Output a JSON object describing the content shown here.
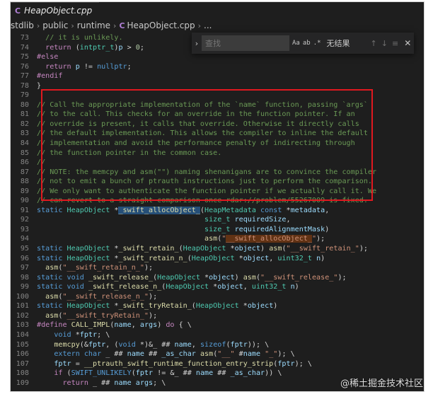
{
  "tab": {
    "label": "HeapObject.cpp",
    "icon": "C"
  },
  "breadcrumb": [
    "stdlib",
    "public",
    "runtime",
    "HeapObject.cpp",
    "..."
  ],
  "find_widget": {
    "placeholder": "查找",
    "options": [
      "Aa",
      "ab",
      ".*"
    ],
    "result": "无结果"
  },
  "watermark": "@稀土掘金技术社区",
  "colors": {
    "editor_bg": "#1e1e1e",
    "highlight_box": "#e0191f",
    "selection": "#264f78"
  },
  "code_lines": [
    {
      "n": "73",
      "html": "  <span class=\"cm\">// it is unlikely.</span>"
    },
    {
      "n": "74",
      "html": "  <span class=\"ctl\">return</span> (<span class=\"ty\">intptr_t</span>)<span class=\"var\">p</span> &gt; <span class=\"num\">0</span>;"
    },
    {
      "n": "75",
      "html": "<span class=\"pp\">#else</span>"
    },
    {
      "n": "76",
      "html": "  <span class=\"ctl\">return</span> <span class=\"var\">p</span> != <span class=\"kw\">nullptr</span>;"
    },
    {
      "n": "77",
      "html": "<span class=\"pp\">#endif</span>"
    },
    {
      "n": "78",
      "html": "}"
    },
    {
      "n": "79",
      "html": ""
    },
    {
      "n": "80",
      "html": "<span class=\"cm\">// Call the appropriate implementation of the `name` function, passing `args`</span>"
    },
    {
      "n": "81",
      "html": "<span class=\"cm\">// to the call. This checks for an override in the function pointer. If an</span>"
    },
    {
      "n": "82",
      "html": "<span class=\"cm\">// override is present, it calls that override. Otherwise it directly calls</span>"
    },
    {
      "n": "83",
      "html": "<span class=\"cm\">// the default implementation. This allows the compiler to inline the default</span>"
    },
    {
      "n": "84",
      "html": "<span class=\"cm\">// implementation and avoid the performance penalty of indirecting through</span>"
    },
    {
      "n": "85",
      "html": "<span class=\"cm\">// the function pointer in the common case.</span>"
    },
    {
      "n": "86",
      "html": "<span class=\"cm\">//</span>"
    },
    {
      "n": "87",
      "html": "<span class=\"cm\">// NOTE: the memcpy and asm(\"\") naming shenanigans are to convince the compiler</span>"
    },
    {
      "n": "88",
      "html": "<span class=\"cm\">// not to emit a bunch of ptrauth instructions just to perform the comparison.</span>"
    },
    {
      "n": "89",
      "html": "<span class=\"cm\">// We only want to authenticate the function pointer if we actually call it. We</span>"
    },
    {
      "n": "90",
      "html": "<span class=\"cm\">// can revert to a straight comparison once rdar://problem/55267009 is fixed.</span>"
    },
    {
      "n": "91",
      "html": "<span class=\"kw\">static</span> <span class=\"ty\">HeapObject</span> *<span class=\"fn hl\">_swift_allocObject_</span>(<span class=\"ty\">HeapMetadata</span> <span class=\"kw\">const</span> *<span class=\"var\">metadata</span>,"
    },
    {
      "n": "92",
      "html": "                                       <span class=\"ty\">size_t</span> <span class=\"var\">requiredSize</span>,"
    },
    {
      "n": "93",
      "html": "                                       <span class=\"ty\">size_t</span> <span class=\"var\">requiredAlignmentMask</span>)"
    },
    {
      "n": "94",
      "html": "                                       <span class=\"fn\">asm</span>(<span class=\"str\">\"<span class=\"shl\">__swift_allocObject_</span>\"</span>);"
    },
    {
      "n": "95",
      "html": "<span class=\"kw\">static</span> <span class=\"ty\">HeapObject</span> *<span class=\"fn\">_swift_retain_</span>(<span class=\"ty\">HeapObject</span> *<span class=\"var\">object</span>) <span class=\"fn\">asm</span>(<span class=\"str\">\"__swift_retain_\"</span>);"
    },
    {
      "n": "96",
      "html": "<span class=\"kw\">static</span> <span class=\"ty\">HeapObject</span> *<span class=\"fn\">_swift_retain_n_</span>(<span class=\"ty\">HeapObject</span> *<span class=\"var\">object</span>, <span class=\"ty\">uint32_t</span> <span class=\"var\">n</span>)"
    },
    {
      "n": "97",
      "html": "  <span class=\"fn\">asm</span>(<span class=\"str\">\"__swift_retain_n_\"</span>);"
    },
    {
      "n": "98",
      "html": "<span class=\"kw\">static</span> <span class=\"kw\">void</span> <span class=\"fn\">_swift_release_</span>(<span class=\"ty\">HeapObject</span> *<span class=\"var\">object</span>) <span class=\"fn\">asm</span>(<span class=\"str\">\"__swift_release_\"</span>);"
    },
    {
      "n": "99",
      "html": "<span class=\"kw\">static</span> <span class=\"kw\">void</span> <span class=\"fn\">_swift_release_n_</span>(<span class=\"ty\">HeapObject</span> *<span class=\"var\">object</span>, <span class=\"ty\">uint32_t</span> <span class=\"var\">n</span>)"
    },
    {
      "n": "100",
      "html": "  <span class=\"fn\">asm</span>(<span class=\"str\">\"__swift_release_n_\"</span>);"
    },
    {
      "n": "101",
      "html": "<span class=\"kw\">static</span> <span class=\"ty\">HeapObject</span> *<span class=\"fn\">_swift_tryRetain_</span>(<span class=\"ty\">HeapObject</span> *<span class=\"var\">object</span>)"
    },
    {
      "n": "102",
      "html": "  <span class=\"fn\">asm</span>(<span class=\"str\">\"__swift_tryRetain_\"</span>);"
    },
    {
      "n": "103",
      "html": "<span class=\"pp\">#define</span> <span class=\"fn\">CALL_IMPL</span>(<span class=\"var\">name</span>, <span class=\"var\">args</span>) <span class=\"ctl\">do</span> { \\"
    },
    {
      "n": "104",
      "html": "    <span class=\"kw\">void</span> *<span class=\"var\">fptr</span>; \\"
    },
    {
      "n": "105",
      "html": "    <span class=\"fn\">memcpy</span>(&amp;<span class=\"var\">fptr</span>, (<span class=\"kw\">void</span> *)&amp;_ ## <span class=\"var\">name</span>, <span class=\"kw\">sizeof</span>(<span class=\"var\">fptr</span>)); \\"
    },
    {
      "n": "106",
      "html": "    <span class=\"kw\">extern</span> <span class=\"kw\">char</span> _ ## <span class=\"var\">name</span> ## <span class=\"var\">_as_char</span> <span class=\"fn\">asm</span>(<span class=\"str\">\"__\"</span> #<span class=\"var\">name</span> <span class=\"str\">\"_\"</span>); \\"
    },
    {
      "n": "107",
      "html": "    <span class=\"var\">fptr</span> = <span class=\"fn\">__ptrauth_swift_runtime_function_entry_strip</span>(<span class=\"var\">fptr</span>); \\"
    },
    {
      "n": "108",
      "html": "    <span class=\"ctl\">if</span> (<span class=\"mac\">SWIFT_UNLIKELY</span>(<span class=\"var\">fptr</span> != &amp;_ ## <span class=\"var\">name</span> ## <span class=\"var\">_as_char</span>)) \\"
    },
    {
      "n": "109",
      "html": "      <span class=\"ctl\">return</span> _ ## <span class=\"var\">name</span> <span class=\"var\">args</span>; \\"
    }
  ]
}
